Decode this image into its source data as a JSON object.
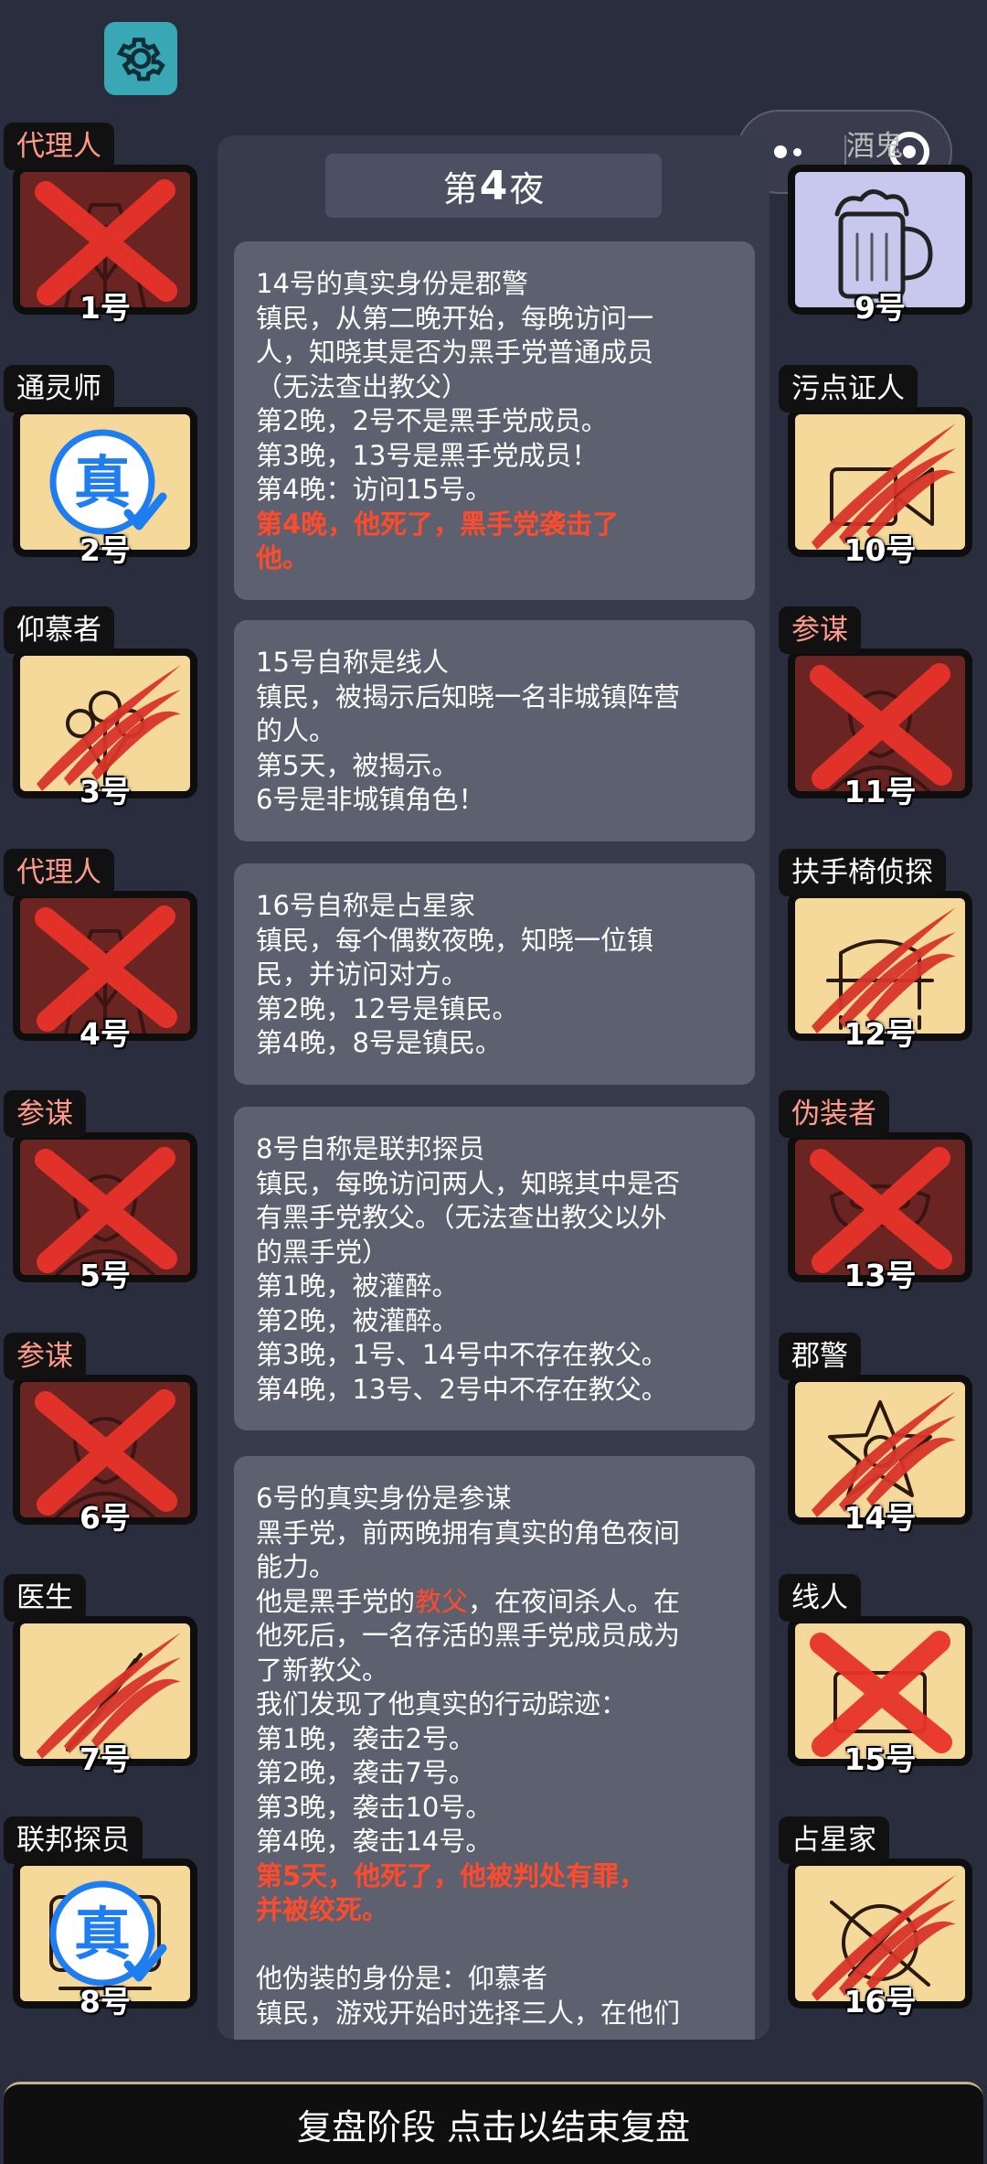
{
  "night": {
    "prefix": "第",
    "number": "4",
    "suffix": "夜"
  },
  "cards": [
    {
      "lines": [
        {
          "text": "14号的真实身份是郡警",
          "red": false
        },
        {
          "text": "镇民，从第二晚开始，每晚访问一",
          "red": false
        },
        {
          "text": "人，知晓其是否为黑手党普通成员",
          "red": false
        },
        {
          "text": "（无法查出教父）",
          "red": false
        },
        {
          "text": "第2晚，2号不是黑手党成员。",
          "red": false
        },
        {
          "text": "第3晚，13号是黑手党成员！",
          "red": false
        },
        {
          "text": "第4晚：访问15号。",
          "red": false
        },
        {
          "text": "第4晚，他死了，黑手党袭击了",
          "red": true
        },
        {
          "text": "他。",
          "red": true
        }
      ]
    },
    {
      "lines": [
        {
          "text": "15号自称是线人",
          "red": false
        },
        {
          "text": "镇民，被揭示后知晓一名非城镇阵营",
          "red": false
        },
        {
          "text": "的人。",
          "red": false
        },
        {
          "text": "第5天，被揭示。",
          "red": false
        },
        {
          "text": "6号是非城镇角色！",
          "red": false
        }
      ]
    },
    {
      "lines": [
        {
          "text": "16号自称是占星家",
          "red": false
        },
        {
          "text": "镇民，每个偶数夜晚，知晓一位镇",
          "red": false
        },
        {
          "text": "民，并访问对方。",
          "red": false
        },
        {
          "text": "第2晚，12号是镇民。",
          "red": false
        },
        {
          "text": "第4晚，8号是镇民。",
          "red": false
        }
      ]
    },
    {
      "lines": [
        {
          "text": "8号自称是联邦探员",
          "red": false
        },
        {
          "text": "镇民，每晚访问两人，知晓其中是否",
          "red": false
        },
        {
          "text": "有黑手党教父。（无法查出教父以外",
          "red": false
        },
        {
          "text": "的黑手党）",
          "red": false
        },
        {
          "text": "第1晚，被灌醉。",
          "red": false
        },
        {
          "text": "第2晚，被灌醉。",
          "red": false
        },
        {
          "text": "第3晚，1号、14号中不存在教父。",
          "red": false
        },
        {
          "text": "第4晚，13号、2号中不存在教父。",
          "red": false
        }
      ]
    },
    {
      "lines": [
        {
          "text": "6号的真实身份是参谋",
          "red": false
        },
        {
          "text": "黑手党，前两晚拥有真实的角色夜间",
          "red": false
        },
        {
          "text": "能力。",
          "red": false
        },
        {
          "text": "",
          "red": false
        },
        {
          "text": "了新教父。",
          "red": false
        },
        {
          "text": "我们发现了他真实的行动踪迹：",
          "red": false
        },
        {
          "text": "第1晚，袭击2号。",
          "red": false
        },
        {
          "text": "第2晚，袭击7号。",
          "red": false
        },
        {
          "text": "第3晚，袭击10号。",
          "red": false
        },
        {
          "text": "第4晚，袭击14号。",
          "red": false
        },
        {
          "text": "第5天，他死了，他被判处有罪，",
          "red": true
        },
        {
          "text": "并被绞死。",
          "red": true
        },
        {
          "text": "",
          "red": false
        },
        {
          "text": "他伪装的身份是：仰慕者",
          "red": false
        },
        {
          "text": "镇民，游戏开始时选择三人，在他们",
          "red": false
        }
      ],
      "godfather": {
        "before": "他是黑手党的",
        "highlight": "教父",
        "after": "，在夜间杀人。在"
      },
      "godfather2": "他死后，一名存活的黑手党成员成为"
    }
  ],
  "players_left": [
    {
      "role": "代理人",
      "number": "1号",
      "state": "dead",
      "mark": "x",
      "icon": "trenchcoat-agent-icon"
    },
    {
      "role": "通灵师",
      "number": "2号",
      "state": "alive",
      "mark": "verified",
      "verified_text": "真",
      "icon": "medium-icon"
    },
    {
      "role": "仰慕者",
      "number": "3号",
      "state": "alive",
      "mark": "claw",
      "icon": "flower-bouquet-icon"
    },
    {
      "role": "代理人",
      "number": "4号",
      "state": "dead",
      "mark": "x",
      "icon": "trenchcoat-agent-icon"
    },
    {
      "role": "参谋",
      "number": "5号",
      "state": "dead",
      "mark": "x",
      "icon": "advisor-icon"
    },
    {
      "role": "参谋",
      "number": "6号",
      "state": "dead",
      "mark": "x",
      "icon": "advisor-icon"
    },
    {
      "role": "医生",
      "number": "7号",
      "state": "alive",
      "mark": "claw",
      "icon": "syringe-icon"
    },
    {
      "role": "联邦探员",
      "number": "8号",
      "state": "alive",
      "mark": "verified",
      "verified_text": "真",
      "icon": "fbi-agent-icon"
    }
  ],
  "players_right": [
    {
      "role": "酒鬼",
      "number": "9号",
      "state": "drunk",
      "mark": "none",
      "icon": "beer-mug-icon"
    },
    {
      "role": "污点证人",
      "number": "10号",
      "state": "alive",
      "mark": "claw",
      "icon": "witness-icon"
    },
    {
      "role": "参谋",
      "number": "11号",
      "state": "dead",
      "mark": "x",
      "icon": "advisor-icon"
    },
    {
      "role": "扶手椅侦探",
      "number": "12号",
      "state": "alive",
      "mark": "claw",
      "icon": "armchair-icon"
    },
    {
      "role": "伪装者",
      "number": "13号",
      "state": "dead",
      "mark": "x",
      "icon": "mask-icon"
    },
    {
      "role": "郡警",
      "number": "14号",
      "state": "alive",
      "mark": "claw",
      "icon": "sheriff-star-icon"
    },
    {
      "role": "线人",
      "number": "15号",
      "state": "alive",
      "mark": "x",
      "icon": "informant-icon"
    },
    {
      "role": "占星家",
      "number": "16号",
      "state": "alive",
      "mark": "claw",
      "icon": "astrolabe-icon"
    }
  ],
  "bottom_bar": {
    "label": "复盘阶段 点击以结束复盘"
  },
  "colors": {
    "background": "#2a2d3d",
    "panel": "#383b4c",
    "card": "#5d606f",
    "highlight_red": "#ff4b2b",
    "dead_tile": "#6a2422",
    "alive_tile": "#f5d99a",
    "x_mark": "#e8332a",
    "verified_blue": "#1e7df0",
    "gear_teal": "#3aa7b4"
  }
}
